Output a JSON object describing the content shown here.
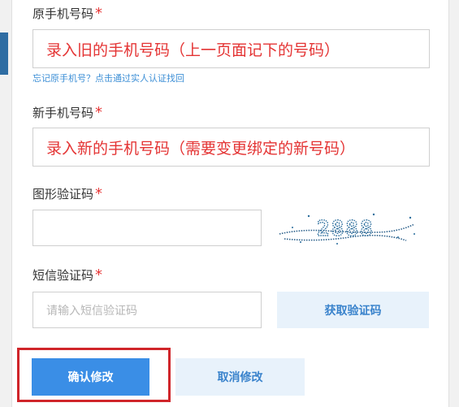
{
  "form": {
    "old_phone": {
      "label": "原手机号码",
      "required_mark": "*",
      "value": "录入旧的手机号码（上一页面记下的号码）"
    },
    "forgot_link": "忘记原手机号？点击通过实人认证找回",
    "new_phone": {
      "label": "新手机号码",
      "required_mark": "*",
      "value": "录入新的手机号码（需要变更绑定的新号码）"
    },
    "image_captcha": {
      "label": "图形验证码",
      "required_mark": "*",
      "value": "",
      "captcha_text": "2888"
    },
    "sms_code": {
      "label": "短信验证码",
      "required_mark": "*",
      "placeholder": "请输入短信验证码",
      "get_code_label": "获取验证码"
    }
  },
  "actions": {
    "confirm_label": "确认修改",
    "cancel_label": "取消修改"
  },
  "colors": {
    "primary": "#3a8ee6",
    "secondary_bg": "#e8f2fb",
    "required": "#e63737",
    "annotation": "#e43434",
    "highlight_border": "#d0252a"
  }
}
